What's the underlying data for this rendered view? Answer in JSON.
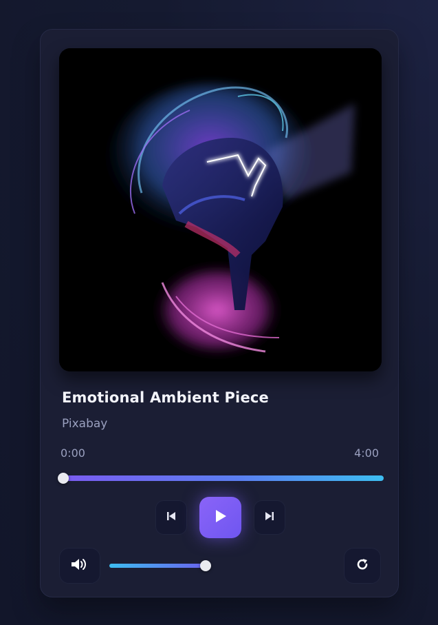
{
  "track": {
    "title": "Emotional Ambient Piece",
    "artist": "Pixabay"
  },
  "progress": {
    "current_time": "0:00",
    "duration": "4:00",
    "position_fraction": 0.0
  },
  "volume": {
    "level_fraction": 1.0
  },
  "controls": {
    "previous_icon": "skip-previous-icon",
    "play_icon": "play-icon",
    "next_icon": "skip-next-icon",
    "volume_icon": "volume-high-icon",
    "repeat_icon": "repeat-icon"
  },
  "colors": {
    "accent": "#7c5cf5",
    "accent_secondary": "#3dbdf0",
    "card_background": "#1b1e34",
    "page_background": "#151a30",
    "title_text": "#f3f4fa",
    "muted_text": "#9aa0bf"
  }
}
